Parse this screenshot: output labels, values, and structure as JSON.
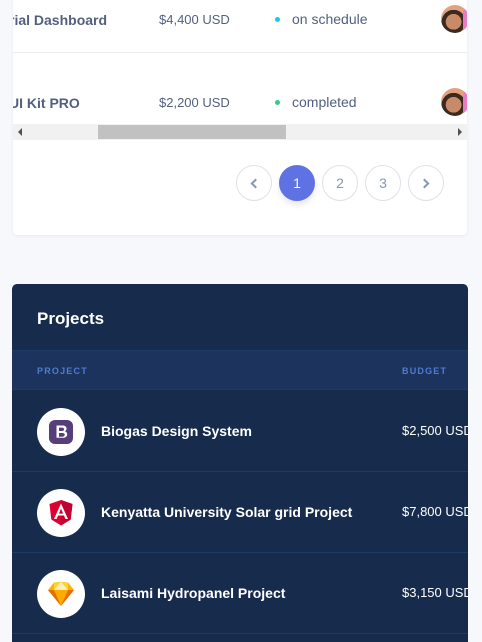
{
  "light_table": {
    "rows": [
      {
        "name": "rial Dashboard",
        "budget": "$4,400 USD",
        "status": "on schedule",
        "status_color": "#11cdef"
      },
      {
        "name": "UI Kit PRO",
        "budget": "$2,200 USD",
        "status": "completed",
        "status_color": "#2dce89"
      }
    ]
  },
  "pagination": {
    "prev_icon": "chevron-left-icon",
    "pages": [
      "1",
      "2",
      "3"
    ],
    "active_page": "1",
    "next_icon": "chevron-right-icon"
  },
  "dark_card": {
    "title": "Projects",
    "columns": {
      "project": "PROJECT",
      "budget": "BUDGET"
    },
    "rows": [
      {
        "name": "Biogas Design System",
        "budget": "$2,500 USD",
        "icon": "bootstrap-icon"
      },
      {
        "name": "Kenyatta University Solar grid Project",
        "budget": "$7,800 USD",
        "icon": "angular-icon"
      },
      {
        "name": "Laisami Hydropanel Project",
        "budget": "$3,150 USD",
        "icon": "sketch-icon"
      }
    ]
  },
  "colors": {
    "accent": "#5e72e4",
    "dark_bg": "#172b4d",
    "page_bg": "#f6f8fc"
  }
}
